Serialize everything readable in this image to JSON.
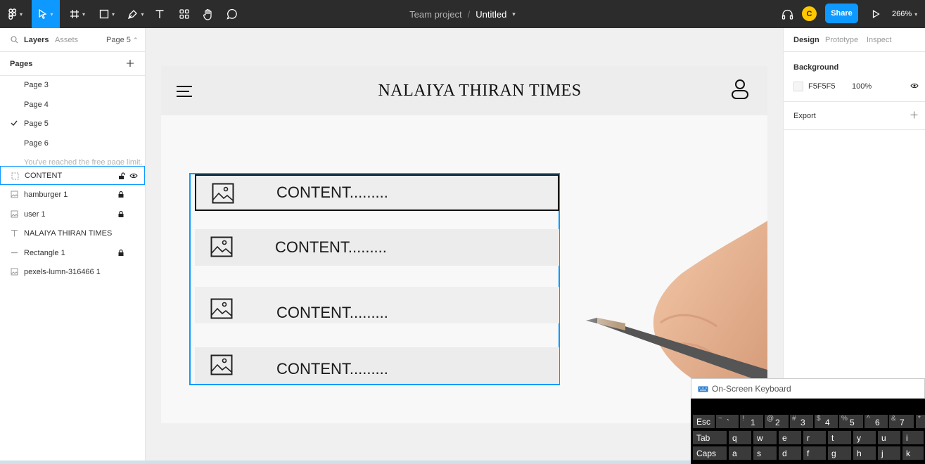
{
  "toolbar": {
    "tools": [
      "figma-menu",
      "move",
      "frame",
      "shape",
      "pen",
      "text",
      "resources",
      "hand",
      "comment"
    ],
    "file_team": "Team project",
    "file_separator": "/",
    "file_name": "Untitled",
    "avatar_initial": "C",
    "share_label": "Share",
    "zoom": "266%"
  },
  "left_panel": {
    "tab_layers": "Layers",
    "tab_assets": "Assets",
    "current_page": "Page 5",
    "pages_title": "Pages",
    "pages": [
      "Page 3",
      "Page 4",
      "Page 5",
      "Page 6"
    ],
    "selected_page": "Page 5",
    "limit_note": "You've reached the free page limit.",
    "layers": [
      {
        "name": "CONTENT",
        "icon": "frame-icon",
        "locked": false,
        "selected": true
      },
      {
        "name": "hamburger 1",
        "icon": "image-icon",
        "locked": true
      },
      {
        "name": "user 1",
        "icon": "image-icon",
        "locked": true
      },
      {
        "name": "NALAIYA THIRAN TIMES",
        "icon": "text-icon",
        "locked": false
      },
      {
        "name": "Rectangle 1",
        "icon": "line-icon",
        "locked": true
      },
      {
        "name": "pexels-lumn-316466 1",
        "icon": "image-icon",
        "locked": false
      }
    ]
  },
  "canvas": {
    "site_title": "NALAIYA THIRAN TIMES",
    "content_rows": [
      "CONTENT.........",
      "CONTENT.........",
      "CONTENT.........",
      "CONTENT........."
    ]
  },
  "right_panel": {
    "tab_design": "Design",
    "tab_prototype": "Prototype",
    "tab_inspect": "Inspect",
    "background_title": "Background",
    "background_hex": "F5F5F5",
    "background_opacity": "100%",
    "export_title": "Export"
  },
  "keyboard": {
    "title": "On-Screen Keyboard",
    "row1": [
      {
        "main": "Esc"
      },
      {
        "sub": "~",
        "num": "`"
      },
      {
        "sub": "!",
        "num": "1"
      },
      {
        "sub": "@",
        "num": "2"
      },
      {
        "sub": "#",
        "num": "3"
      },
      {
        "sub": "$",
        "num": "4"
      },
      {
        "sub": "%",
        "num": "5"
      },
      {
        "sub": "^",
        "num": "6"
      },
      {
        "sub": "&",
        "num": "7"
      },
      {
        "sub": "*",
        "num": ""
      }
    ],
    "row2": [
      "Tab",
      "q",
      "w",
      "e",
      "r",
      "t",
      "y",
      "u",
      "i"
    ],
    "row3": [
      "Caps",
      "a",
      "s",
      "d",
      "f",
      "g",
      "h",
      "j",
      "k"
    ]
  }
}
